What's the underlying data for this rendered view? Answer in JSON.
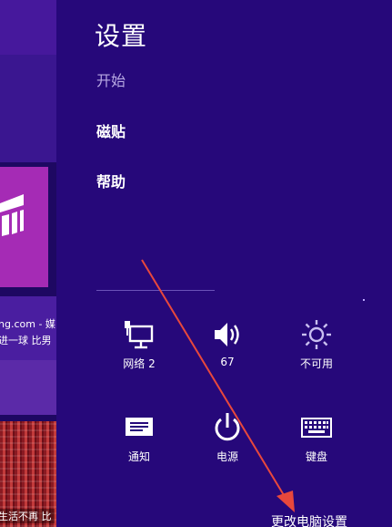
{
  "start_screen": {
    "news_tile": {
      "line1": "ng.com - 媒",
      "line2": "进一球 比男"
    },
    "photo_tile": {
      "caption": "生活不再 比"
    }
  },
  "settings_panel": {
    "title": "设置",
    "items": [
      {
        "label": "开始"
      },
      {
        "label": "磁贴"
      },
      {
        "label": "帮助"
      }
    ],
    "quick_settings": [
      {
        "label": "网络  2",
        "icon": "network-icon"
      },
      {
        "label": "67",
        "icon": "volume-icon"
      },
      {
        "label": "不可用",
        "icon": "brightness-icon"
      },
      {
        "label": "通知",
        "icon": "notifications-icon"
      },
      {
        "label": "电源",
        "icon": "power-icon"
      },
      {
        "label": "键盘",
        "icon": "keyboard-icon"
      }
    ],
    "change_pc_settings": "更改电脑设置"
  },
  "colors": {
    "panel_background": "#26087a",
    "annotation_arrow": "#e8483c"
  }
}
